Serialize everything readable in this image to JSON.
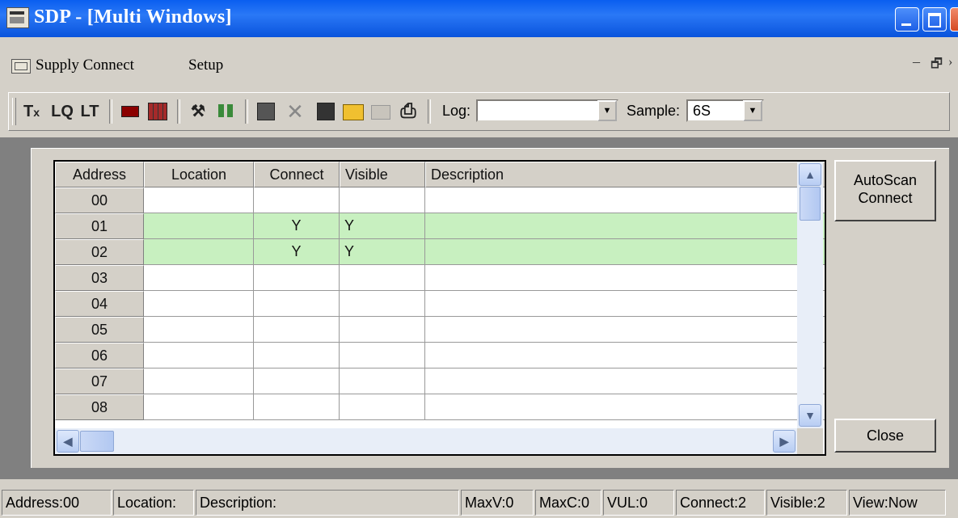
{
  "window": {
    "title": "SDP - [Multi Windows]"
  },
  "menu": {
    "items": [
      "Supply Connect",
      "Setup"
    ],
    "mdi_min": "–",
    "mdi_restore": "🗗",
    "mdi_close": "›"
  },
  "toolbar": {
    "log_label": "Log:",
    "log_value": "",
    "sample_label": "Sample:",
    "sample_value": "6S",
    "icons": [
      "tx-icon",
      "lq-icon",
      "lt-icon",
      "wave-icon",
      "grid-red-icon",
      "magic-wand-icon",
      "tiles-icon",
      "save-icon",
      "delete-icon",
      "disk-icon",
      "open-folder-icon",
      "folder-disabled-icon",
      "print-icon"
    ]
  },
  "grid": {
    "columns": [
      "Address",
      "Location",
      "Connect",
      "Visible",
      "Description"
    ],
    "rows": [
      {
        "address": "00",
        "location": "",
        "connect": "",
        "visible": "",
        "description": ""
      },
      {
        "address": "01",
        "location": "",
        "connect": "Y",
        "visible": "Y",
        "description": ""
      },
      {
        "address": "02",
        "location": "",
        "connect": "Y",
        "visible": "Y",
        "description": ""
      },
      {
        "address": "03",
        "location": "",
        "connect": "",
        "visible": "",
        "description": ""
      },
      {
        "address": "04",
        "location": "",
        "connect": "",
        "visible": "",
        "description": ""
      },
      {
        "address": "05",
        "location": "",
        "connect": "",
        "visible": "",
        "description": ""
      },
      {
        "address": "06",
        "location": "",
        "connect": "",
        "visible": "",
        "description": ""
      },
      {
        "address": "07",
        "location": "",
        "connect": "",
        "visible": "",
        "description": ""
      },
      {
        "address": "08",
        "location": "",
        "connect": "",
        "visible": "",
        "description": ""
      }
    ],
    "highlight_color": "#c8f0c0"
  },
  "buttons": {
    "autoscan_line1": "AutoScan",
    "autoscan_line2": "Connect",
    "close": "Close"
  },
  "status": {
    "address": "Address:00",
    "location": "Location:",
    "description": "Description:",
    "maxv": "MaxV:0",
    "maxc": "MaxC:0",
    "vul": "VUL:0",
    "connect": "Connect:2",
    "visible": "Visible:2",
    "view": "View:Now"
  },
  "colors": {
    "title_bar": "#0a5ef0",
    "face": "#d4d0c8",
    "workspace": "#808080"
  }
}
